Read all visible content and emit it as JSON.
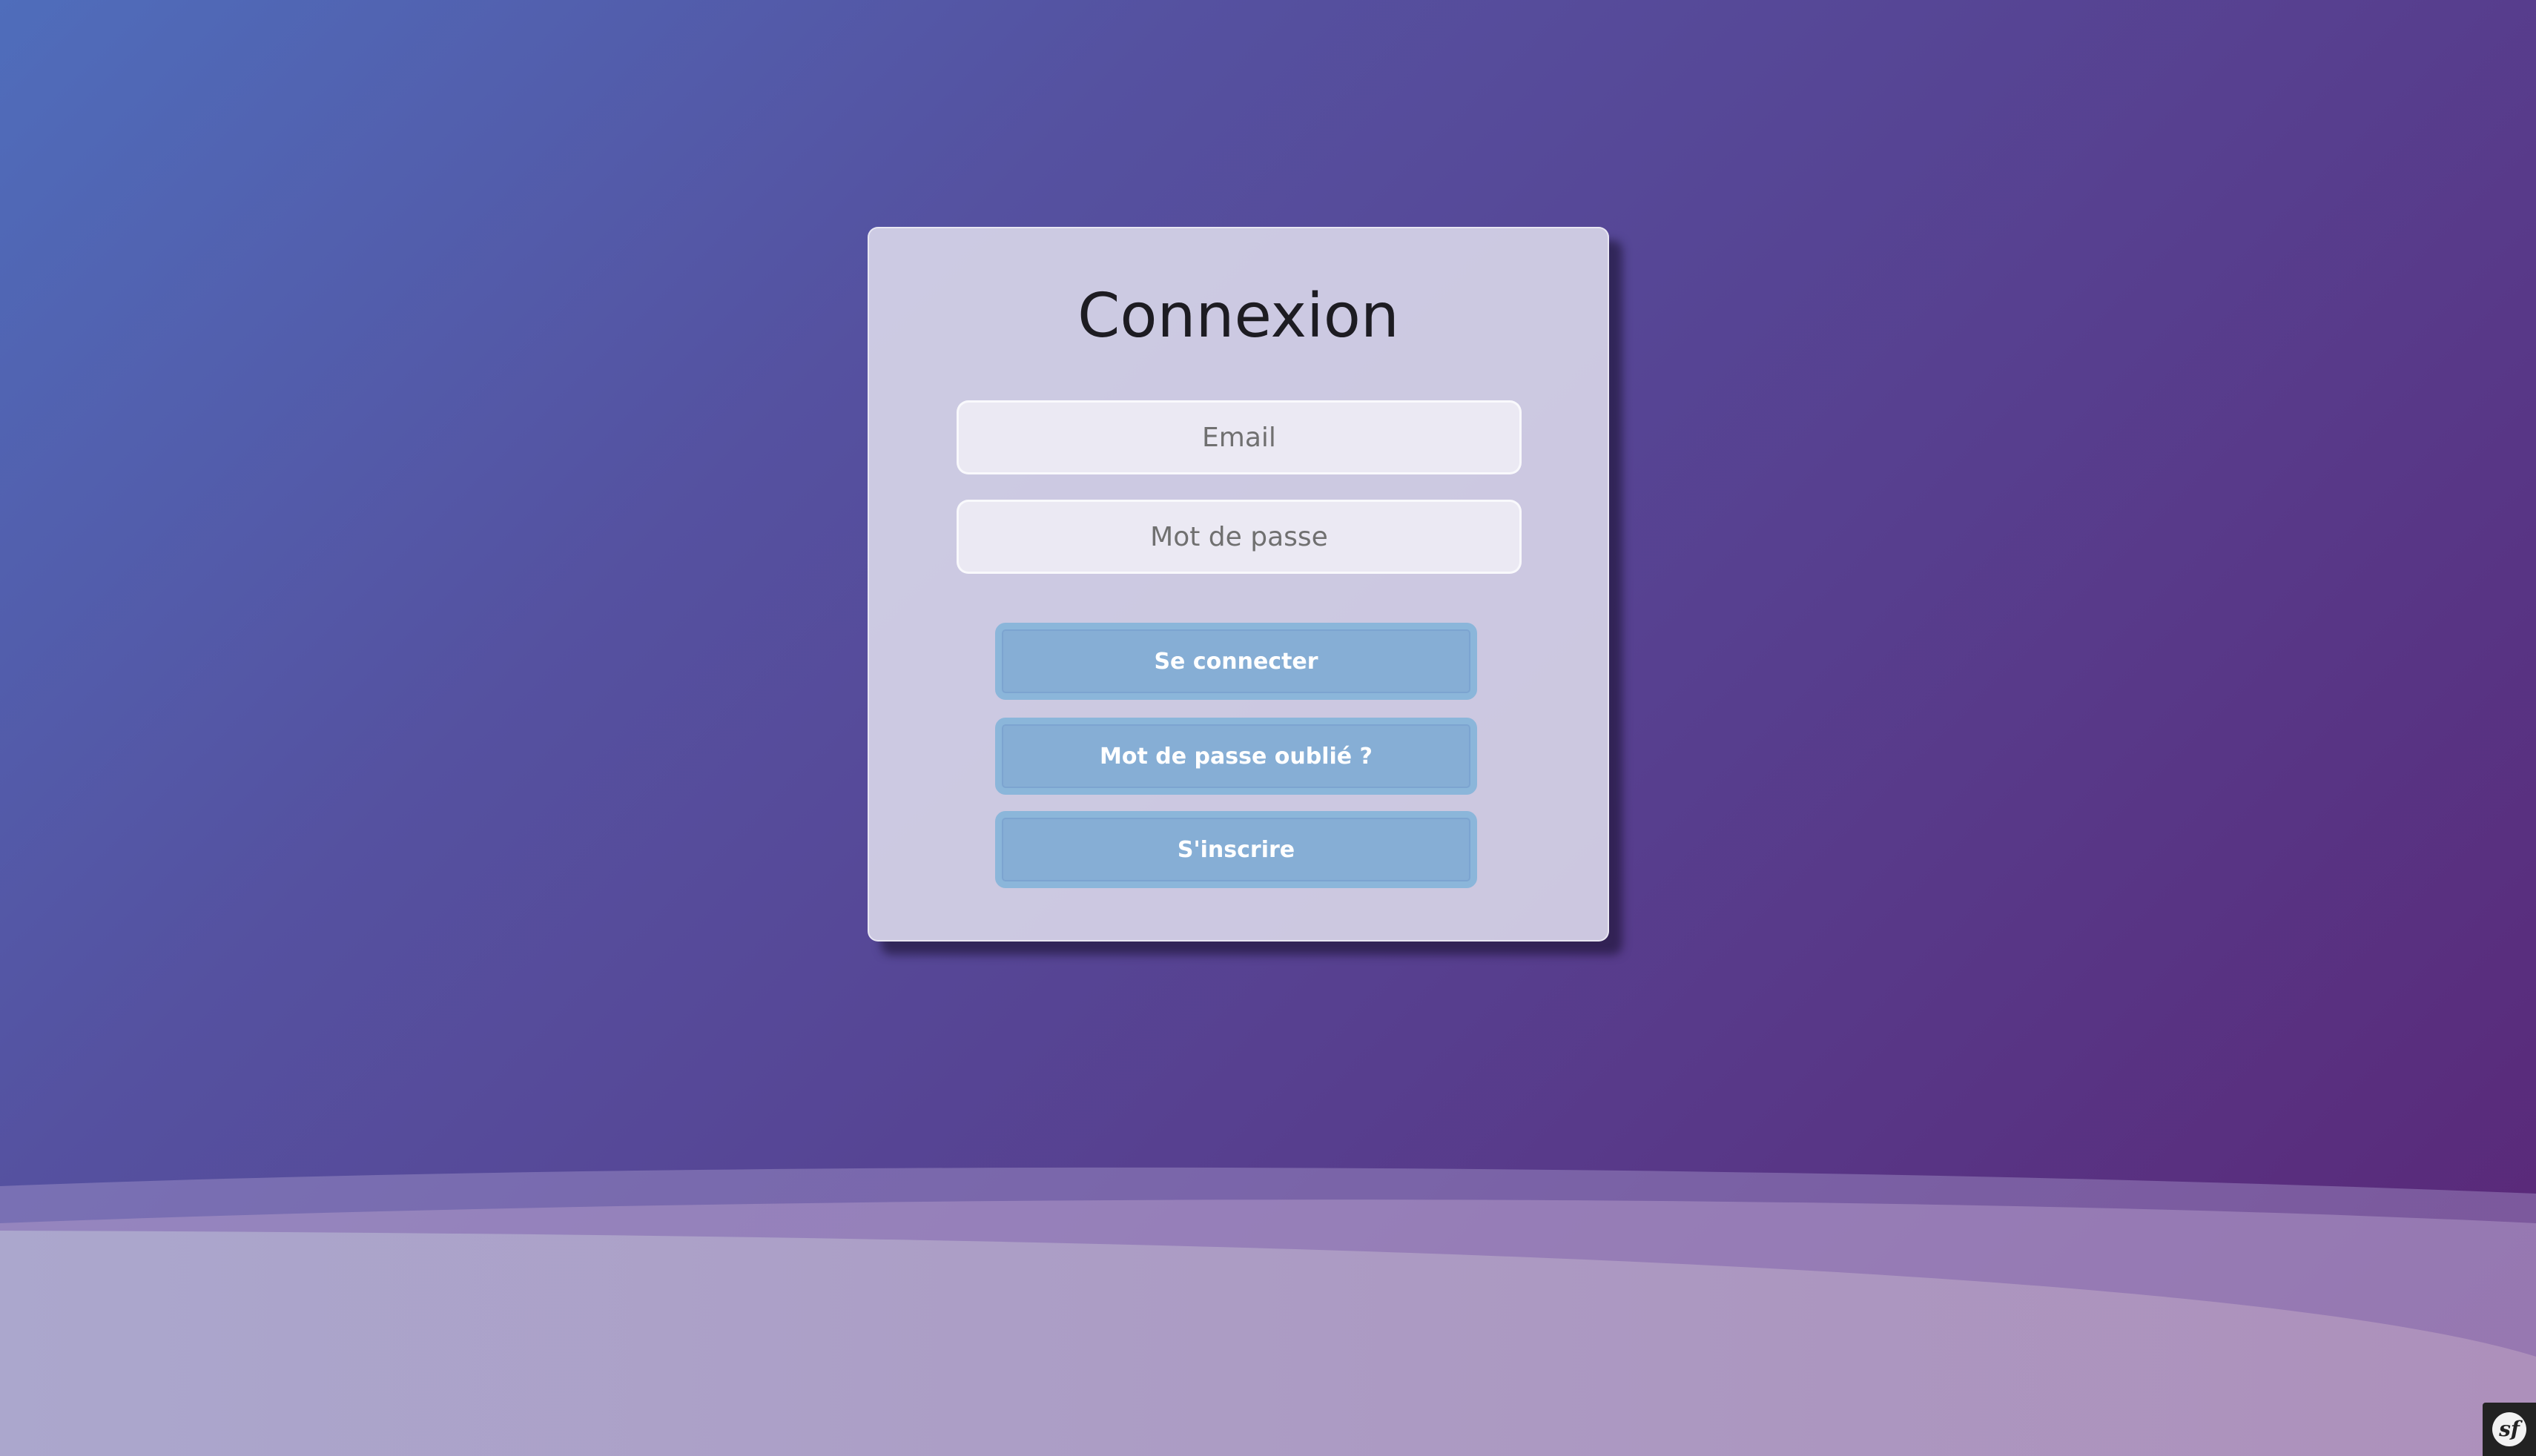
{
  "login": {
    "title": "Connexion",
    "email_placeholder": "Email",
    "password_placeholder": "Mot de passe",
    "login_button": "Se connecter",
    "forgot_button": "Mot de passe oublié ?",
    "signup_button": "S'inscrire"
  },
  "debug_toolbar": {
    "icon": "symfony-logo-icon",
    "logo_text": "sf"
  },
  "colors": {
    "background_start": "#4f6dbb",
    "background_end": "#5a2676",
    "card_background": "#d8d5e8",
    "button_background": "#86aed5",
    "button_border": "#8bb6da",
    "button_text": "#ffffff",
    "title_text": "#1d1c22",
    "toolbar_background": "#222222"
  }
}
